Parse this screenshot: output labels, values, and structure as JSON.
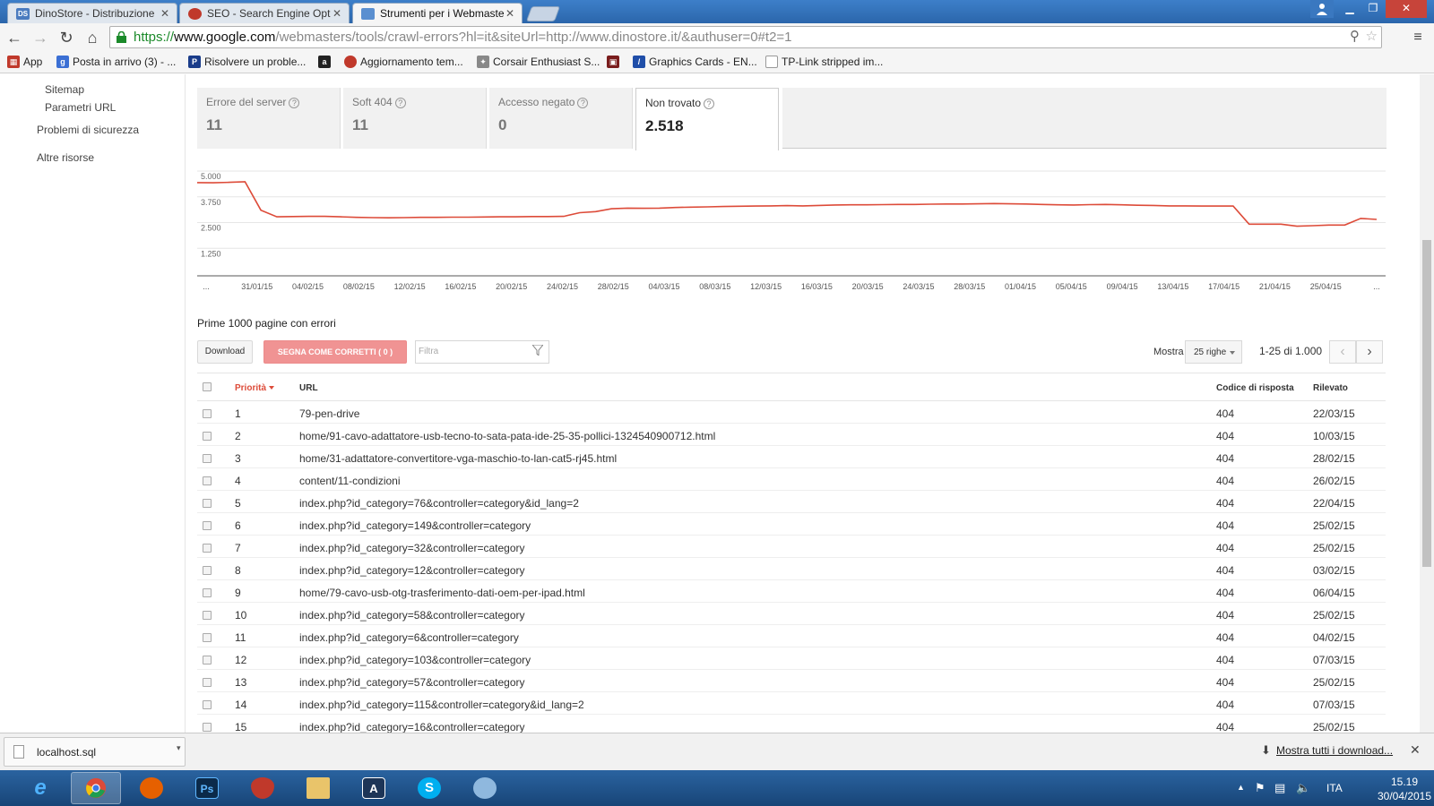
{
  "browser": {
    "tabs": [
      {
        "label": "DinoStore - Distribuzione",
        "favicon": "DS",
        "color": "#4a7bbf"
      },
      {
        "label": "SEO - Search Engine Opt",
        "favicon": "",
        "color": "#c0392b"
      },
      {
        "label": "Strumenti per i Webmaste",
        "favicon": "",
        "color": "#5a8fd0"
      }
    ],
    "url": {
      "scheme": "https://",
      "host": "www.google.com",
      "path": "/webmasters/tools/crawl-errors?hl=it&siteUrl=http://www.dinostore.it/&authuser=0#t2=1"
    },
    "bookmarks": [
      {
        "label": "App",
        "icon": "apps-icon",
        "color": "#c0392b"
      },
      {
        "label": "Posta in arrivo (3) - ...",
        "icon": "gplus-icon",
        "color": "#3b6fd4"
      },
      {
        "label": "Risolvere un proble...",
        "icon": "paypal-icon",
        "color": "#1a3c8a"
      },
      {
        "label": "",
        "icon": "amazon-icon",
        "color": "#222222"
      },
      {
        "label": "Aggiornamento tem...",
        "icon": "strawberry-icon",
        "color": "#c0392b"
      },
      {
        "label": "Corsair Enthusiast S...",
        "icon": "corsair-icon",
        "color": "#888888"
      },
      {
        "label": "",
        "icon": "gift-icon",
        "color": "#7a1d1d"
      },
      {
        "label": "Graphics Cards - EN...",
        "icon": "asus-icon",
        "color": "#1f4ea8"
      },
      {
        "label": "TP-Link stripped im...",
        "icon": "page-icon",
        "color": "#ffffff"
      }
    ]
  },
  "sidebar": {
    "items": [
      {
        "label": "Sitemap"
      },
      {
        "label": "Parametri URL"
      },
      {
        "label": "Problemi di sicurezza"
      },
      {
        "label": "Altre risorse"
      }
    ]
  },
  "stats": [
    {
      "label": "Errore del server",
      "value": "11"
    },
    {
      "label": "Soft 404",
      "value": "11"
    },
    {
      "label": "Accesso negato",
      "value": "0"
    },
    {
      "label": "Non trovato",
      "value": "2.518"
    }
  ],
  "chart_data": {
    "type": "line",
    "title": "",
    "xlabel": "",
    "ylabel": "",
    "ylim": [
      0,
      5000
    ],
    "yticks": [
      "5.000",
      "3.750",
      "2.500",
      "1.250"
    ],
    "xticks": [
      "...",
      "31/01/15",
      "04/02/15",
      "08/02/15",
      "12/02/15",
      "16/02/15",
      "20/02/15",
      "24/02/15",
      "28/02/15",
      "04/03/15",
      "08/03/15",
      "12/03/15",
      "16/03/15",
      "20/03/15",
      "24/03/15",
      "28/03/15",
      "01/04/15",
      "05/04/15",
      "09/04/15",
      "13/04/15",
      "17/04/15",
      "21/04/15",
      "25/04/15",
      "..."
    ],
    "grid": true,
    "color": "#dd4b39",
    "values": [
      4440,
      4430,
      4450,
      4480,
      3100,
      2780,
      2790,
      2800,
      2800,
      2780,
      2750,
      2740,
      2730,
      2740,
      2750,
      2750,
      2760,
      2760,
      2770,
      2780,
      2780,
      2790,
      2790,
      2800,
      2980,
      3030,
      3170,
      3200,
      3190,
      3200,
      3230,
      3250,
      3260,
      3280,
      3290,
      3300,
      3310,
      3320,
      3310,
      3330,
      3350,
      3360,
      3360,
      3370,
      3380,
      3380,
      3390,
      3400,
      3400,
      3410,
      3420,
      3410,
      3400,
      3380,
      3360,
      3350,
      3370,
      3380,
      3360,
      3340,
      3330,
      3310,
      3310,
      3300,
      3300,
      3300,
      2420,
      2420,
      2420,
      2320,
      2350,
      2380,
      2380,
      2700,
      2650
    ]
  },
  "table": {
    "title": "Prime 1000 pagine con errori",
    "download_label": "Download",
    "mark_label": "SEGNA COME CORRETTI ( 0 )",
    "filter_placeholder": "Filtra",
    "show_label": "Mostra",
    "rows_select": "25 righe",
    "range": "1-25 di 1.000",
    "headers": {
      "priority": "Priorità",
      "url": "URL",
      "code": "Codice di risposta",
      "date": "Rilevato"
    },
    "rows": [
      {
        "priority": "1",
        "url": "79-pen-drive",
        "code": "404",
        "date": "22/03/15"
      },
      {
        "priority": "2",
        "url": "home/91-cavo-adattatore-usb-tecno-to-sata-pata-ide-25-35-pollici-1324540900712.html",
        "code": "404",
        "date": "10/03/15"
      },
      {
        "priority": "3",
        "url": "home/31-adattatore-convertitore-vga-maschio-to-lan-cat5-rj45.html",
        "code": "404",
        "date": "28/02/15"
      },
      {
        "priority": "4",
        "url": "content/11-condizioni",
        "code": "404",
        "date": "26/02/15"
      },
      {
        "priority": "5",
        "url": "index.php?id_category=76&controller=category&id_lang=2",
        "code": "404",
        "date": "22/04/15"
      },
      {
        "priority": "6",
        "url": "index.php?id_category=149&controller=category",
        "code": "404",
        "date": "25/02/15"
      },
      {
        "priority": "7",
        "url": "index.php?id_category=32&controller=category",
        "code": "404",
        "date": "25/02/15"
      },
      {
        "priority": "8",
        "url": "index.php?id_category=12&controller=category",
        "code": "404",
        "date": "03/02/15"
      },
      {
        "priority": "9",
        "url": "home/79-cavo-usb-otg-trasferimento-dati-oem-per-ipad.html",
        "code": "404",
        "date": "06/04/15"
      },
      {
        "priority": "10",
        "url": "index.php?id_category=58&controller=category",
        "code": "404",
        "date": "25/02/15"
      },
      {
        "priority": "11",
        "url": "index.php?id_category=6&controller=category",
        "code": "404",
        "date": "04/02/15"
      },
      {
        "priority": "12",
        "url": "index.php?id_category=103&controller=category",
        "code": "404",
        "date": "07/03/15"
      },
      {
        "priority": "13",
        "url": "index.php?id_category=57&controller=category",
        "code": "404",
        "date": "25/02/15"
      },
      {
        "priority": "14",
        "url": "index.php?id_category=115&controller=category&id_lang=2",
        "code": "404",
        "date": "07/03/15"
      },
      {
        "priority": "15",
        "url": "index.php?id_category=16&controller=category",
        "code": "404",
        "date": "25/02/15"
      }
    ]
  },
  "download_bar": {
    "file": "localhost.sql",
    "show_all": "Mostra tutti i download..."
  },
  "taskbar": {
    "apps": [
      {
        "name": "ie-icon",
        "label": "e",
        "color": "#2a8fd8"
      },
      {
        "name": "chrome-icon",
        "label": "",
        "color": "#dd4b39"
      },
      {
        "name": "firefox-icon",
        "label": "",
        "color": "#e66000"
      },
      {
        "name": "photoshop-icon",
        "label": "Ps",
        "color": "#0b2a4a"
      },
      {
        "name": "strawberry-icon",
        "label": "",
        "color": "#c0392b"
      },
      {
        "name": "explorer-icon",
        "label": "",
        "color": "#e9c46a"
      },
      {
        "name": "editor-icon",
        "label": "A",
        "color": "#1d3557"
      },
      {
        "name": "skype-icon",
        "label": "S",
        "color": "#00aff0"
      },
      {
        "name": "paint-icon",
        "label": "",
        "color": "#8fb8de"
      }
    ],
    "lang": "ITA",
    "time": "15.19",
    "date": "30/04/2015"
  }
}
